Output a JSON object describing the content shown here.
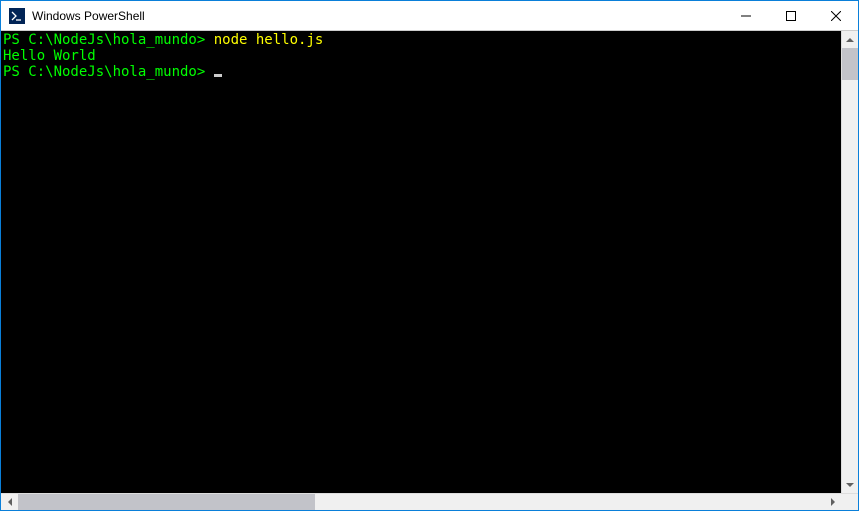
{
  "window": {
    "title": "Windows PowerShell"
  },
  "terminal": {
    "lines": [
      {
        "prompt": "PS C:\\NodeJs\\hola_mundo>",
        "command": " node hello.js"
      },
      {
        "output": "Hello World"
      },
      {
        "prompt": "PS C:\\NodeJs\\hola_mundo>",
        "cursor": true
      }
    ]
  }
}
